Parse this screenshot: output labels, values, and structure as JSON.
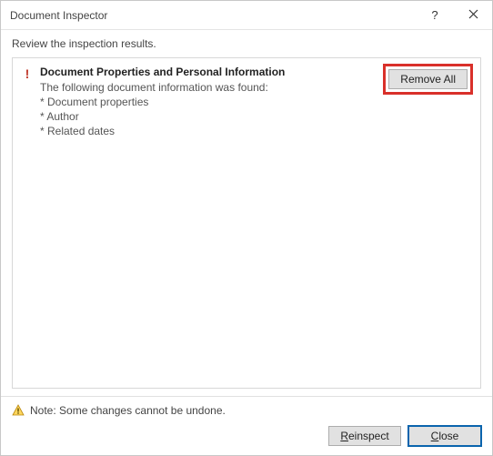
{
  "window": {
    "title": "Document Inspector"
  },
  "subtitle": "Review the inspection results.",
  "result": {
    "heading": "Document Properties and Personal Information",
    "description": "The following document information was found:",
    "items": [
      "* Document properties",
      "* Author",
      "* Related dates"
    ],
    "remove_label": "Remove All"
  },
  "note": "Note: Some changes cannot be undone.",
  "buttons": {
    "reinspect": "Reinspect",
    "close": "Close"
  }
}
